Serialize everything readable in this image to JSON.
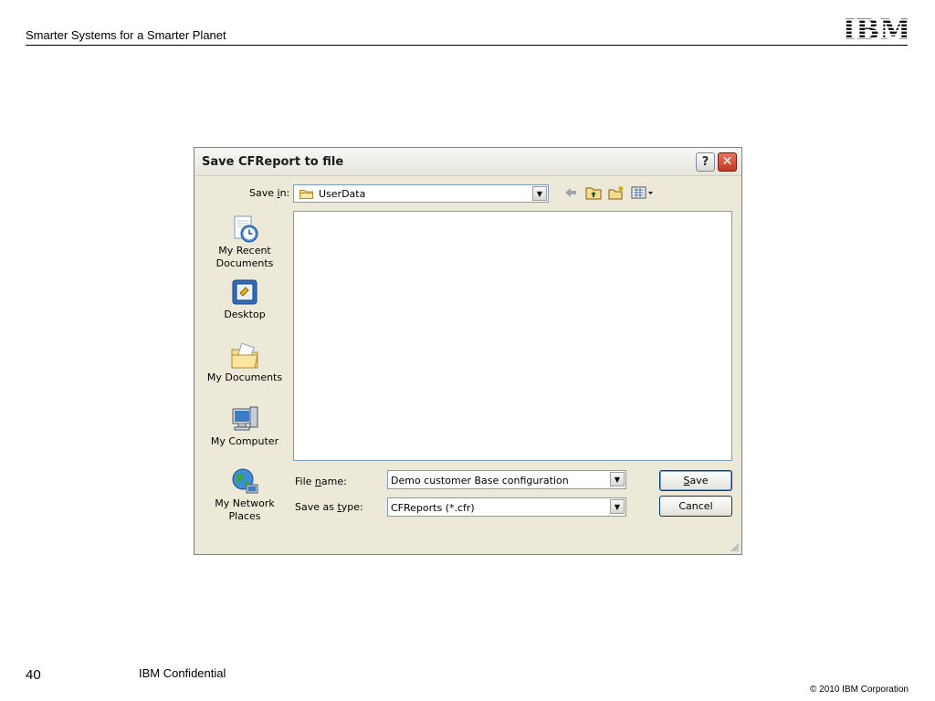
{
  "slide": {
    "header": "Smarter Systems for a Smarter Planet",
    "logo": "IBM",
    "page_number": "40",
    "confidential": "IBM Confidential",
    "copyright": "© 2010 IBM Corporation"
  },
  "dialog": {
    "title": "Save CFReport to file",
    "help_label": "?",
    "close_label": "✕",
    "save_in": {
      "label_pre": "Save ",
      "label_mnemonic": "i",
      "label_post": "n:",
      "value": "UserData"
    },
    "places": [
      {
        "name": "recent",
        "line1": "My Recent",
        "line2": "Documents"
      },
      {
        "name": "desktop",
        "line1": "Desktop",
        "line2": ""
      },
      {
        "name": "documents",
        "line1": "My Documents",
        "line2": ""
      },
      {
        "name": "computer",
        "line1": "My Computer",
        "line2": ""
      },
      {
        "name": "network",
        "line1": "My Network",
        "line2": "Places"
      }
    ],
    "file_name": {
      "label_pre": "File ",
      "label_mnemonic": "n",
      "label_post": "ame:",
      "value": "Demo customer Base configuration"
    },
    "save_as_type": {
      "label_pre": "Save as ",
      "label_mnemonic": "t",
      "label_post": "ype:",
      "value": "CFReports (*.cfr)"
    },
    "buttons": {
      "save_mnemonic": "S",
      "save_rest": "ave",
      "cancel": "Cancel"
    },
    "dropdown_arrow": "▼"
  },
  "icons": [
    "back-icon",
    "up-folder-icon",
    "new-folder-icon",
    "views-menu-icon",
    "folder-icon",
    "help-icon",
    "close-icon"
  ],
  "colors": {
    "dialog_face": "#ece9d8",
    "field_border": "#7f9db9",
    "close_red": "#c23a22",
    "button_border": "#003c74"
  }
}
